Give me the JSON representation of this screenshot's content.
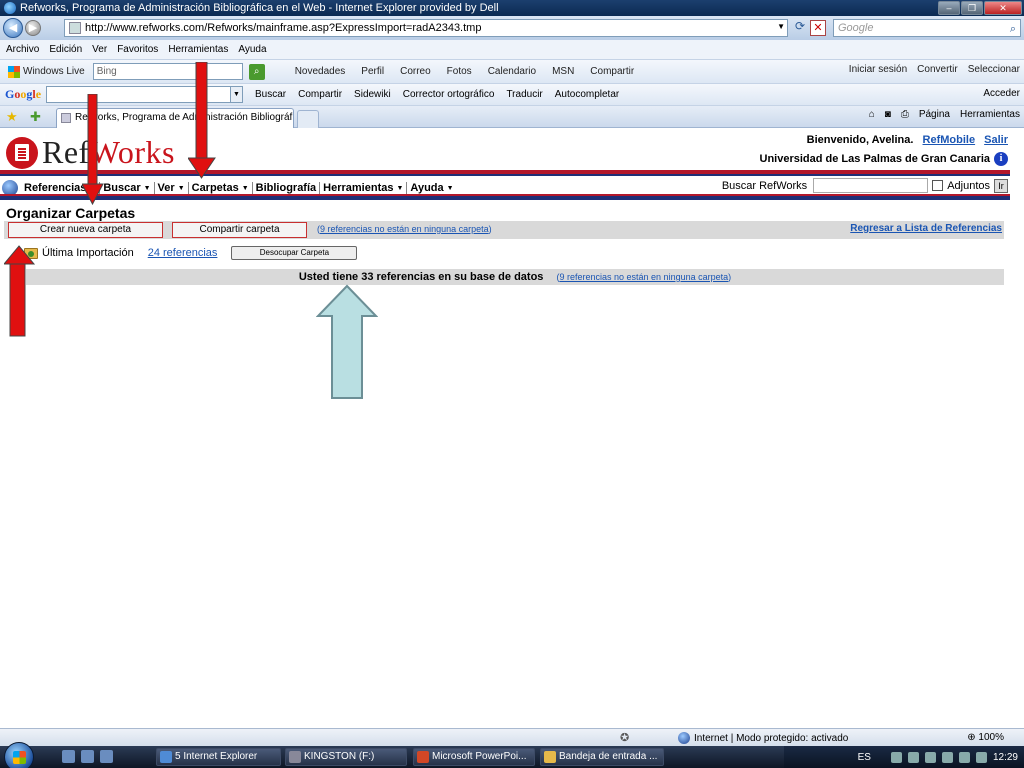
{
  "window": {
    "title": "Refworks, Programa de Administración Bibliográfica en el Web - Internet Explorer provided by Dell",
    "buttons": [
      "–",
      "❐",
      "✕"
    ]
  },
  "address_bar": {
    "url": "http://www.refworks.com/Refworks/mainframe.asp?ExpressImport=radA2343.tmp",
    "search_placeholder": "Google"
  },
  "menu": [
    "Archivo",
    "Edición",
    "Ver",
    "Favoritos",
    "Herramientas",
    "Ayuda"
  ],
  "windows_live_bar": {
    "brand": "Windows Live",
    "search_value": "Bing",
    "items": [
      "Novedades",
      "Perfil",
      "Correo",
      "Fotos",
      "Calendario",
      "MSN",
      "Compartir"
    ],
    "right": [
      "Iniciar sesión",
      "Convertir",
      "Seleccionar"
    ]
  },
  "google_bar": {
    "logo": [
      "G",
      "o",
      "o",
      "g",
      "l",
      "e"
    ],
    "items": [
      "Buscar",
      "Compartir",
      "Sidewiki",
      "Corrector ortográfico",
      "Traducir",
      "Autocompletar"
    ],
    "right": [
      "Acceder"
    ]
  },
  "tabs": [
    {
      "label": "Refworks, Programa de Administración Bibliográf..."
    }
  ],
  "command_bar": [
    "Página",
    "Herramientas"
  ],
  "refworks": {
    "logo": {
      "ref": "Ref",
      "works": "Works"
    },
    "welcome": "Bienvenido, Avelina.",
    "refmobile": "RefMobile",
    "logout": "Salir",
    "institution": "Universidad de Las Palmas de Gran Canaria",
    "nav": [
      "Referencias",
      "Buscar",
      "Ver",
      "Carpetas",
      "Bibliografía",
      "Herramientas",
      "Ayuda"
    ],
    "search_label": "Buscar RefWorks",
    "attachments_label": "Adjuntos",
    "go_label": "Ir",
    "page_title": "Organizar Carpetas",
    "btn_new_folder": "Crear nueva carpeta",
    "btn_share_folder": "Compartir carpeta",
    "unfiled_count": "9",
    "unfiled_text": "referencias no están en ninguna carpeta",
    "back_link": "Regresar a Lista de Referencias",
    "folder": {
      "name": "Última Importación",
      "count": "24 referencias",
      "empty_btn": "Desocupar Carpeta"
    },
    "summary": "Usted tiene 33 referencias en su base de datos"
  },
  "status_bar": {
    "zone": "Internet | Modo protegido: activado",
    "zoom": "100%"
  },
  "taskbar": {
    "tasks": [
      "5 Internet Explorer",
      "KINGSTON (F:)",
      "Microsoft PowerPoi...",
      "Bandeja de entrada ..."
    ],
    "lang": "ES",
    "clock": "12:29"
  },
  "colors": {
    "red_arrow": "#e01010",
    "blue_arrow": "#b9dfe2",
    "refworks_red": "#c9141c",
    "refworks_blue": "#1f2f77"
  }
}
